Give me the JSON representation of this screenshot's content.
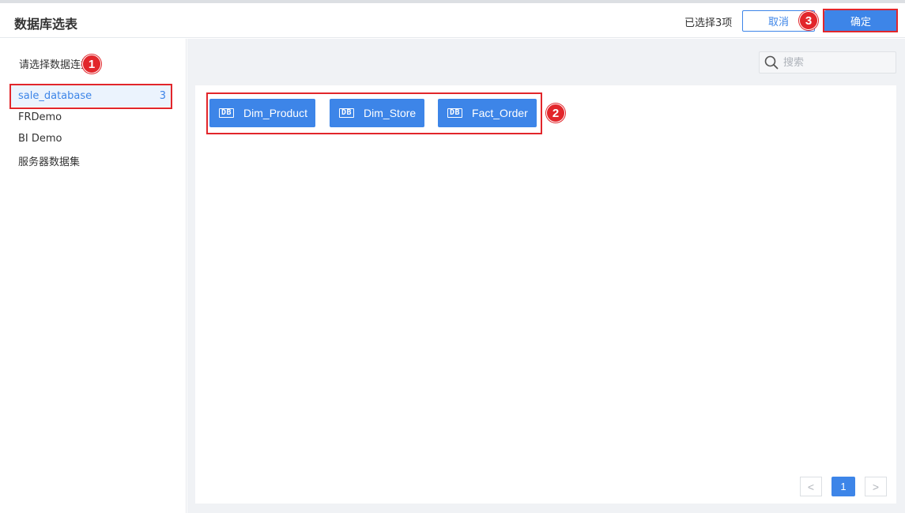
{
  "header": {
    "title": "数据库选表",
    "selected_text": "已选择3项",
    "cancel_label": "取消",
    "confirm_label": "确定"
  },
  "sidebar": {
    "title": "请选择数据连接",
    "items": [
      {
        "label": "sale_database",
        "count": "3",
        "active": true
      },
      {
        "label": "FRDemo",
        "count": ""
      },
      {
        "label": "BI Demo",
        "count": ""
      },
      {
        "label": "服务器数据集",
        "count": ""
      }
    ]
  },
  "search": {
    "placeholder": "搜索"
  },
  "tables": [
    {
      "icon_text": "DB",
      "label": "Dim_Product"
    },
    {
      "icon_text": "DB",
      "label": "Dim_Store"
    },
    {
      "icon_text": "DB",
      "label": "Fact_Order"
    }
  ],
  "pagination": {
    "prev": "<",
    "current": "1",
    "next": ">"
  },
  "annotations": {
    "marker_1": "1",
    "marker_2": "2",
    "marker_3": "3"
  },
  "colors": {
    "primary": "#3d85e8",
    "highlight": "#e2262b"
  }
}
